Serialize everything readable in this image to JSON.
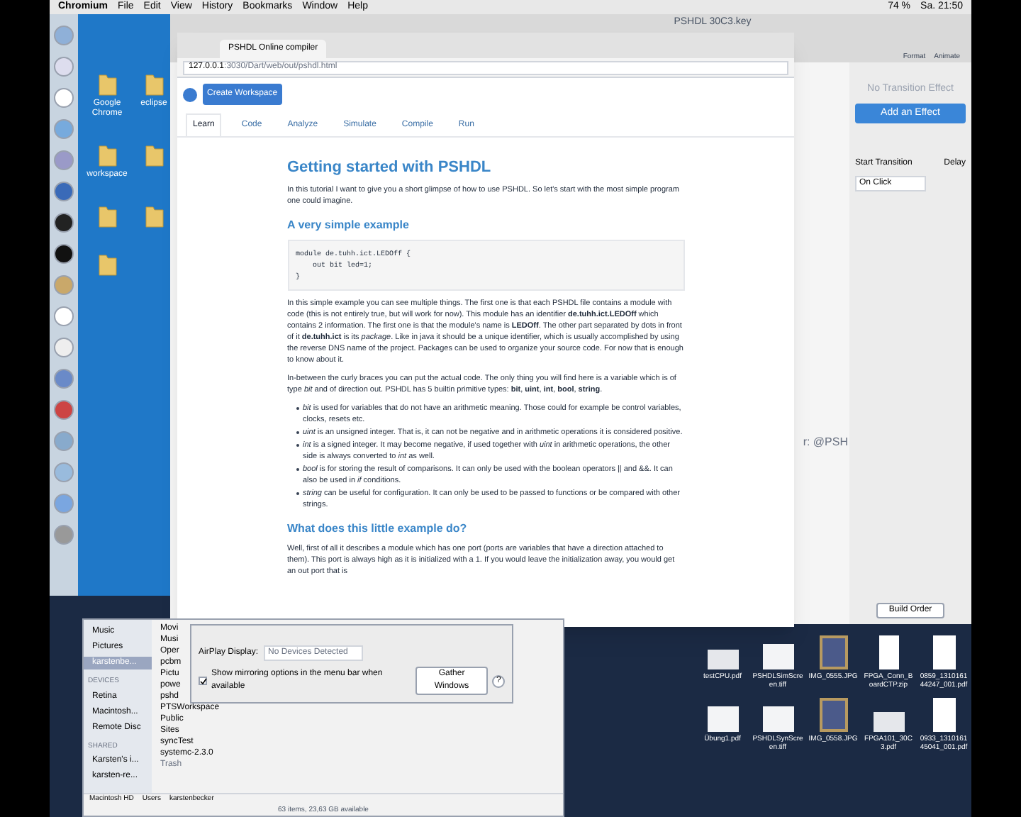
{
  "menubar": {
    "app": "Chromium",
    "menus": [
      "File",
      "Edit",
      "View",
      "History",
      "Bookmarks",
      "Window",
      "Help"
    ],
    "battery": "74 %",
    "clock": "Sa. 21:50"
  },
  "windows_desktop": {
    "icons": [
      {
        "label": "Google Chrome"
      },
      {
        "label": "eclipse"
      },
      {
        "label": "workspace"
      }
    ]
  },
  "keynote": {
    "title": "PSHDL 30C3.key",
    "toolbar": [
      "Format",
      "Animate"
    ],
    "no_effect": "No Transition Effect",
    "add_effect": "Add an Effect",
    "start_label": "Start Transition",
    "delay_label": "Delay",
    "start_value": "On Click",
    "build_order": "Build Order",
    "slide_text": "r: @PSH"
  },
  "browser": {
    "tab": "PSHDL Online compiler",
    "url_host": "127.0.0.1",
    "url_rest": ":3030/Dart/web/out/pshdl.html",
    "create": "Create Workspace",
    "tabs": [
      {
        "label": "Learn",
        "selected": true
      },
      {
        "label": "Code",
        "selected": false
      },
      {
        "label": "Analyze",
        "selected": false
      },
      {
        "label": "Simulate",
        "selected": false
      },
      {
        "label": "Compile",
        "selected": false
      },
      {
        "label": "Run",
        "selected": false
      }
    ],
    "content": [
      {
        "kind": "h1",
        "text": "Getting started with PSHDL"
      },
      {
        "kind": "p",
        "text": "In this tutorial I want to give you a short glimpse of how to use PSHDL. So let's start with the most simple program one could imagine."
      },
      {
        "kind": "h2",
        "text": "A very simple example"
      },
      {
        "kind": "code",
        "lines": [
          "module de.tuhh.ict.LEDOff {",
          "    out bit led=1;",
          "}"
        ]
      },
      {
        "kind": "p",
        "text": "In this simple example you can see multiple things. The first one is that each PSHDL file contains a module with code (this is not entirely true, but will work for now). This module has an identifier **de.tuhh.ict.LEDOff** which contains 2 information. The first one is that the module's name is **LEDOff**. The other part separated by dots in front of it **de.tuhh.ict** is its *package*. Like in java it should be a unique identifier, which is usually accomplished by using the reverse DNS name of the project. Packages can be used to organize your source code. For now that is enough to know about it."
      },
      {
        "kind": "p",
        "text": "In-between the curly braces you can put the actual code. The only thing you will find here is a variable which is of type *bit* and of direction out. PSHDL has 5 builtin primitive types: **bit**, **uint**, **int**, **bool**, **string**."
      },
      {
        "kind": "ul",
        "items": [
          "*bit* is used for variables that do not have an arithmetic meaning. Those could for example be control variables, clocks, resets etc.",
          "*uint* is an unsigned integer. That is, it can not be negative and in arithmetic operations it is considered positive.",
          "*int* is a signed integer. It may become negative, if used together with *uint* in arithmetic operations, the other side is always converted to *int* as well.",
          "*bool* is for storing the result of comparisons. It can only be used with the boolean operators || and &&. It can also be used in *if* conditions.",
          "*string* can be useful for configuration. It can only be used to be passed to functions or be compared with other strings."
        ]
      },
      {
        "kind": "h2",
        "text": "What does this little example do?"
      },
      {
        "kind": "p",
        "text": "Well, first of all it describes a module which has one port (ports are variables that have a direction attached to them). This port is always high as it is initialized with a 1. If you would leave the initialization away, you would get an out port that is"
      }
    ]
  },
  "finder": {
    "sidebar": [
      {
        "kind": "item",
        "label": "Music",
        "selected": false
      },
      {
        "kind": "item",
        "label": "Pictures",
        "selected": false
      },
      {
        "kind": "item",
        "label": "karstenbe...",
        "selected": true
      },
      {
        "kind": "header",
        "label": "DEVICES"
      },
      {
        "kind": "item",
        "label": "Retina",
        "selected": false
      },
      {
        "kind": "item",
        "label": "Macintosh...",
        "selected": false
      },
      {
        "kind": "item",
        "label": "Remote Disc",
        "selected": false
      },
      {
        "kind": "header",
        "label": "SHARED"
      },
      {
        "kind": "item",
        "label": "Karsten's i...",
        "selected": false
      },
      {
        "kind": "item",
        "label": "karsten-re...",
        "selected": false
      }
    ],
    "files": [
      {
        "name": "Movi",
        "disabled": false
      },
      {
        "name": "Musi",
        "disabled": false
      },
      {
        "name": "Oper",
        "disabled": false
      },
      {
        "name": "pcbm",
        "disabled": false
      },
      {
        "name": "Pictu",
        "disabled": false
      },
      {
        "name": "powe",
        "disabled": false
      },
      {
        "name": "pshd",
        "disabled": false
      },
      {
        "name": "PTSWorkspace",
        "disabled": false
      },
      {
        "name": "Public",
        "disabled": false
      },
      {
        "name": "Sites",
        "disabled": false
      },
      {
        "name": "syncTest",
        "disabled": false
      },
      {
        "name": "systemc-2.3.0",
        "disabled": false
      },
      {
        "name": "Trash",
        "disabled": true
      }
    ],
    "path": [
      "Macintosh HD",
      "Users",
      "karstenbecker"
    ],
    "status": "63 items, 23,63 GB available"
  },
  "display_dialog": {
    "airplay_label": "AirPlay Display:",
    "airplay_value": "No Devices Detected",
    "mirroring": {
      "label": "Show mirroring options in the menu bar when available",
      "checked": true
    },
    "gather": "Gather Windows",
    "help": "?"
  },
  "desktop_files": [
    {
      "name": "testCPU.pdf",
      "kind": "doc"
    },
    {
      "name": "PSHDLSimScreen.tiff",
      "kind": "image"
    },
    {
      "name": "IMG_0555.JPG",
      "kind": "photo"
    },
    {
      "name": "FPGA_Conn_BoardCTP.zip",
      "kind": "zip"
    },
    {
      "name": "0859_131016144247_001.pdf",
      "kind": "page"
    },
    {
      "name": "Übung1.pdf",
      "kind": "image"
    },
    {
      "name": "PSHDLSynScreen.tiff",
      "kind": "image"
    },
    {
      "name": "IMG_0558.JPG",
      "kind": "photo"
    },
    {
      "name": "FPGA101_30C3.pdf",
      "kind": "doc"
    },
    {
      "name": "0933_131016145041_001.pdf",
      "kind": "page"
    }
  ]
}
